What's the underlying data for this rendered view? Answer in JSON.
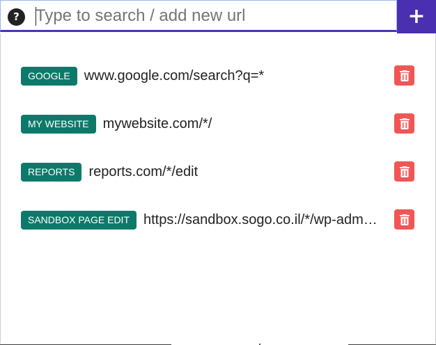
{
  "search": {
    "help_glyph": "?",
    "placeholder": "Type to search / add new url",
    "add_glyph": "+"
  },
  "colors": {
    "accent": "#4a2fb0",
    "chip": "#0c7a6a",
    "delete": "#f25555"
  },
  "items": [
    {
      "label": "GOOGLE",
      "url": "www.google.com/search?q=*"
    },
    {
      "label": "MY WEBSITE",
      "url": "mywebsite.com/*/"
    },
    {
      "label": "REPORTS",
      "url": "reports.com/*/edit"
    },
    {
      "label": "SANDBOX PAGE EDIT",
      "url": "https://sandbox.sogo.co.il/*/wp-adm…"
    }
  ],
  "icons": {
    "help": "question-circle-icon",
    "add": "plus-icon",
    "delete": "trash-icon"
  }
}
